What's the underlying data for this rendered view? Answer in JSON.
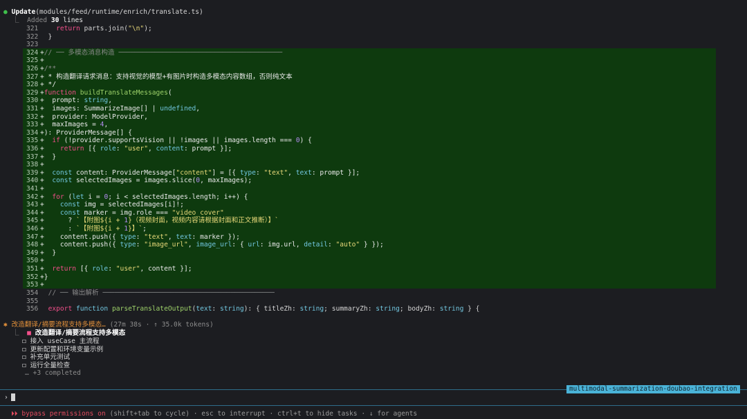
{
  "tool_call": {
    "name": "Update",
    "arg": "(modules/feed/runtime/enrich/translate.ts)",
    "summary_prefix": "⎿  Added ",
    "summary_count": "30",
    "summary_suffix": " lines"
  },
  "task": {
    "spinner": "✱",
    "title": "改造翻译/摘要流程支持多模态…",
    "meta": "(27m 38s · ↑ 35.0k tokens)",
    "active": "改造翻译/摘要流程支持多模态",
    "items": [
      "接入 useCase 主流程",
      "更新配置和环境变量示例",
      "补充单元测试",
      "运行全量检查"
    ],
    "completed": "… +3 completed"
  },
  "status": {
    "branch": "multimodal-summarization-doubao-integration",
    "prompt_symbol": "›"
  },
  "footer": {
    "bypass": "⏵⏵ bypass permissions on",
    "rest": " (shift+tab to cycle) · esc to interrupt · ctrl+t to hide tasks · ↓ for agents"
  },
  "colors": {
    "diff_bg": "#0e3a0e",
    "branch_bg": "#4ab3d8",
    "keyword": "#f14f8a",
    "string": "#e8d979"
  }
}
